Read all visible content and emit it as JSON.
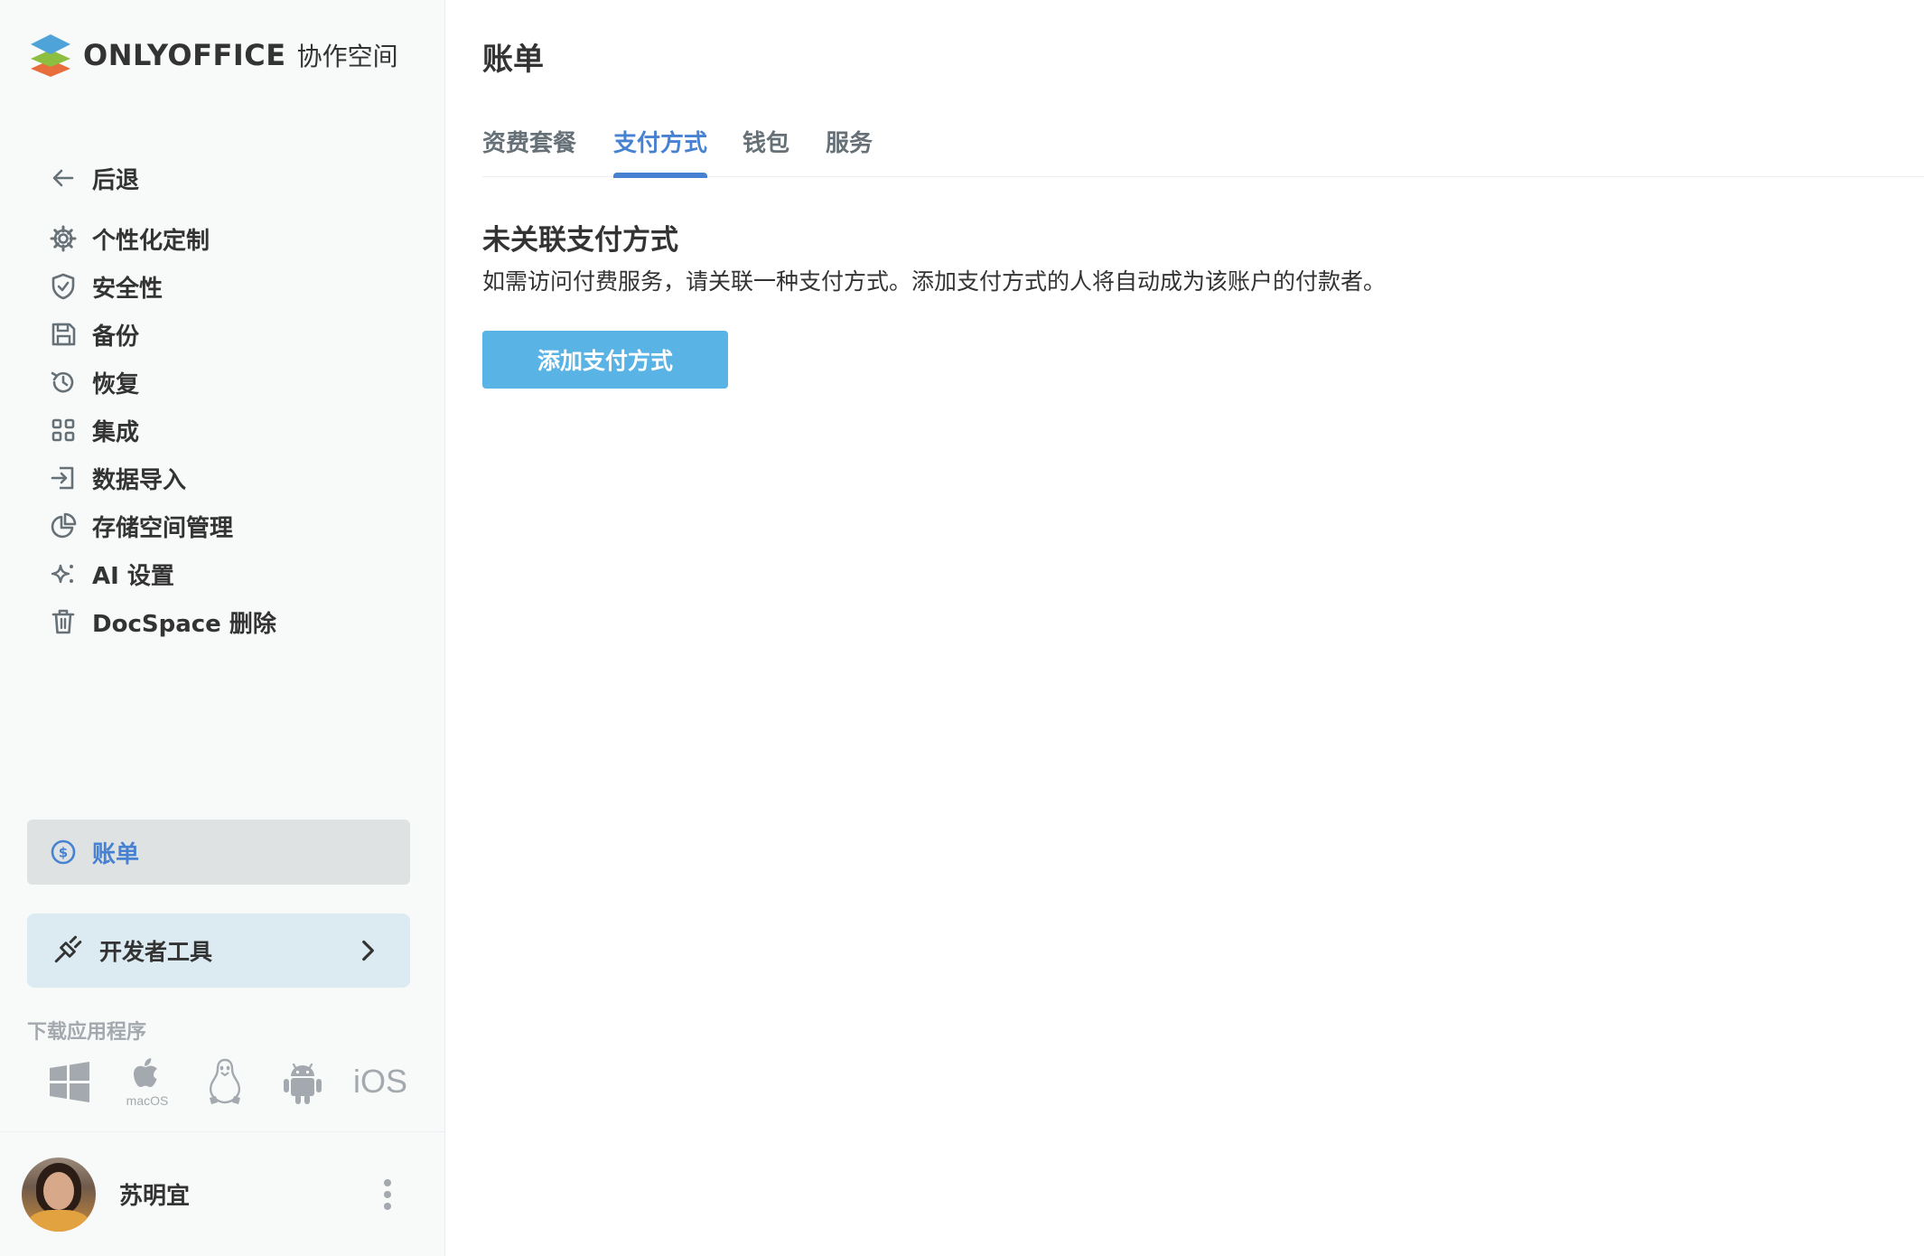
{
  "app": {
    "brand": "ONLYOFFICE",
    "brand_sub": "协作空间"
  },
  "sidebar": {
    "back_label": "后退",
    "items": [
      {
        "label": "个性化定制",
        "icon": "gear-icon"
      },
      {
        "label": "安全性",
        "icon": "shield-icon"
      },
      {
        "label": "备份",
        "icon": "save-icon"
      },
      {
        "label": "恢复",
        "icon": "history-icon"
      },
      {
        "label": "集成",
        "icon": "grid-icon"
      },
      {
        "label": "数据导入",
        "icon": "import-icon"
      },
      {
        "label": "存储空间管理",
        "icon": "pie-chart-icon"
      },
      {
        "label": "AI 设置",
        "icon": "sparkle-icon"
      },
      {
        "label": "DocSpace 删除",
        "icon": "trash-icon"
      }
    ],
    "active_item": {
      "label": "账单",
      "icon": "dollar-icon"
    },
    "dev_tools_label": "开发者工具",
    "download_title": "下载应用程序",
    "apps": [
      {
        "name": "windows-icon"
      },
      {
        "name": "macos-icon",
        "label": "macOS"
      },
      {
        "name": "linux-icon"
      },
      {
        "name": "android-icon"
      },
      {
        "name": "ios-icon",
        "label": "iOS"
      }
    ],
    "user": {
      "name": "苏明宜"
    }
  },
  "main": {
    "title": "账单",
    "tabs": [
      {
        "label": "资费套餐",
        "active": false
      },
      {
        "label": "支付方式",
        "active": true
      },
      {
        "label": "钱包",
        "active": false
      },
      {
        "label": "服务",
        "active": false
      }
    ],
    "section_title": "未关联支付方式",
    "section_desc": "如需访问付费服务，请关联一种支付方式。添加支付方式的人将自动成为该账户的付款者。",
    "add_button_label": "添加支付方式"
  },
  "colors": {
    "accent": "#4781d1",
    "button": "#59b3e5",
    "sidebar_bg": "#f8f9f9",
    "dev_tools_bg": "#dcebf2",
    "active_bg": "#dfe2e3"
  }
}
